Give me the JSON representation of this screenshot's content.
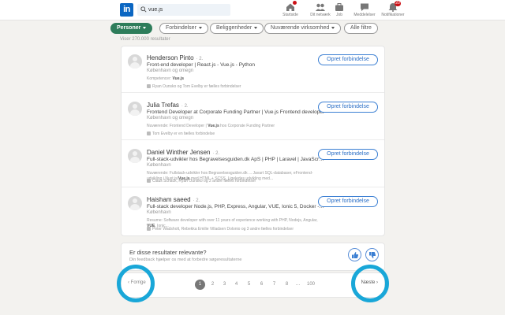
{
  "header": {
    "logo": "in",
    "search_value": "vue.js",
    "nav": [
      {
        "label": "Startside",
        "icon": "home-icon",
        "badge": ""
      },
      {
        "label": "Dit netværk",
        "icon": "network-icon",
        "badge": ""
      },
      {
        "label": "Job",
        "icon": "briefcase-icon",
        "badge": ""
      },
      {
        "label": "Meddelelser",
        "icon": "messaging-icon",
        "badge": ""
      },
      {
        "label": "Notifikationer",
        "icon": "bell-icon",
        "badge": "20"
      }
    ]
  },
  "filters": {
    "people": "Personer",
    "connections": "Forbindelser",
    "locations": "Beliggenheder",
    "current_company": "Nuværende virksomhed",
    "all": "Alle filtre"
  },
  "result_count": "Viser 270.000 resultater",
  "results": [
    {
      "name": "Henderson Pinto",
      "degree": "· 2.",
      "title": "Front-end developer | React.js - Vue.js - Python",
      "location": "København og omegn",
      "detail_prefix": "Kompetencer: ",
      "detail_highlight": "Vue.js",
      "detail_suffix": "",
      "connections": "Ryan Ounsko og Tom Evelby er fælles forbindelser",
      "action": "Opret forbindelse"
    },
    {
      "name": "Julia Trefas",
      "degree": "· 2.",
      "title": "Frontend Developer at Corporate Funding Partner | Vue.js Frontend developer",
      "location": "København og omegn",
      "detail_prefix": "Nuværende: Frontend Developer | ",
      "detail_highlight": "Vue.js",
      "detail_suffix": " hos Corporate Funding Partner",
      "connections": "Tom Evelby er en fælles forbindelse",
      "action": "Opret forbindelse"
    },
    {
      "name": "Daniel Winther Jensen",
      "degree": "· 2.",
      "title": "Full-stack-udvikler hos Begravelsesguiden.dk ApS | PHP | Laravel | JavaScript | Nuxt.js",
      "location": "København",
      "detail_prefix": "Nuværende: Fullstack-udvikler hos Begravelsesguiden.dk ... Javart SQL-databaser, eFrontend-udvikling i Nuxt.js/",
      "detail_highlight": "Vue.js",
      "detail_suffix": " med HTML + SCSS. Ligeledes udvikling med...",
      "connections": "Claus Schack, Ryan Ounsko og 2 andre fælles forbindelser",
      "action": "Opret forbindelse"
    },
    {
      "name": "Haisham saeed",
      "degree": "· 2.",
      "title": "Full-stack developer Node.js, PHP, Express, Angular, VUE, Ionic 5, Docker - 10+ years of...",
      "location": "København",
      "detail_prefix": "Resume: Software developer with over 11 years of experience working with PHP, Nodejs, Angular, ",
      "detail_highlight": "VUE",
      "detail_suffix": ", Ionic...",
      "connections": "Peter Wadsholt, Rebekka Emilie Villadsen Dolonio og 3 andre fælles forbindelser",
      "action": "Opret forbindelse"
    }
  ],
  "feedback": {
    "question": "Er disse resultater relevante?",
    "subtext": "Din feedback hjælper os med at forbedre søgeresultaterne"
  },
  "pagination": {
    "prev": "Forrige",
    "next": "Næste",
    "pages": [
      "1",
      "2",
      "3",
      "4",
      "5",
      "6",
      "7",
      "8",
      "…",
      "100"
    ],
    "current": "1"
  },
  "highlight_color": "#19a7d8",
  "accent_color": "#2e7d5b"
}
